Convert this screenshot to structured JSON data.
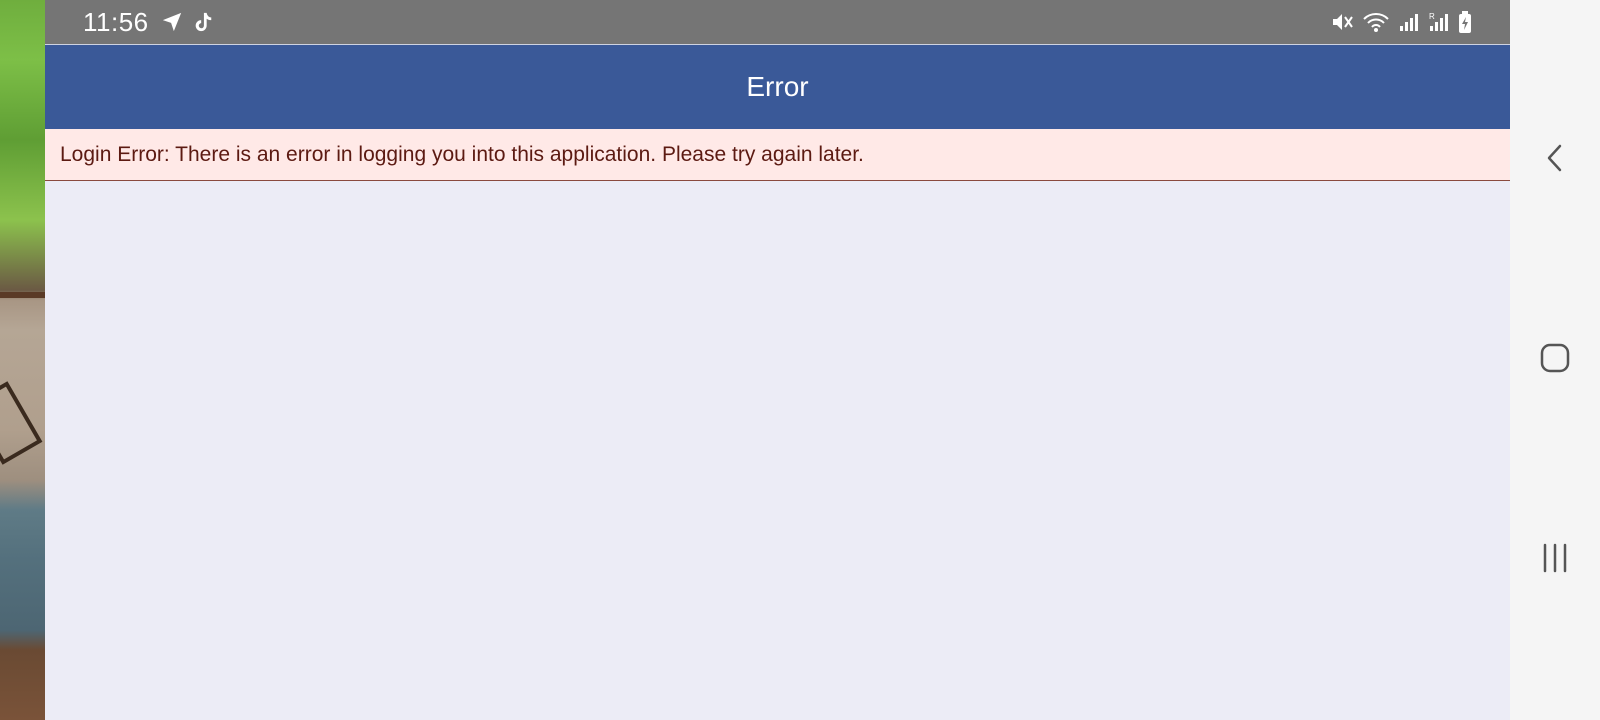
{
  "status_bar": {
    "time": "11:56",
    "left_icons": [
      "navigation-arrow-icon",
      "tiktok-icon"
    ],
    "right_icons": [
      "mute-icon",
      "wifi-icon",
      "signal-icon",
      "signal-roaming-icon",
      "battery-charging-icon"
    ]
  },
  "app_bar": {
    "title": "Error",
    "color": "#3a5998"
  },
  "error_banner": {
    "message": "Login Error: There is an error in logging you into this application. Please try again later.",
    "background": "#ffe9e7",
    "text_color": "#5c1a12"
  },
  "nav_bar": {
    "buttons": [
      "back-icon",
      "home-icon",
      "recents-icon"
    ]
  }
}
